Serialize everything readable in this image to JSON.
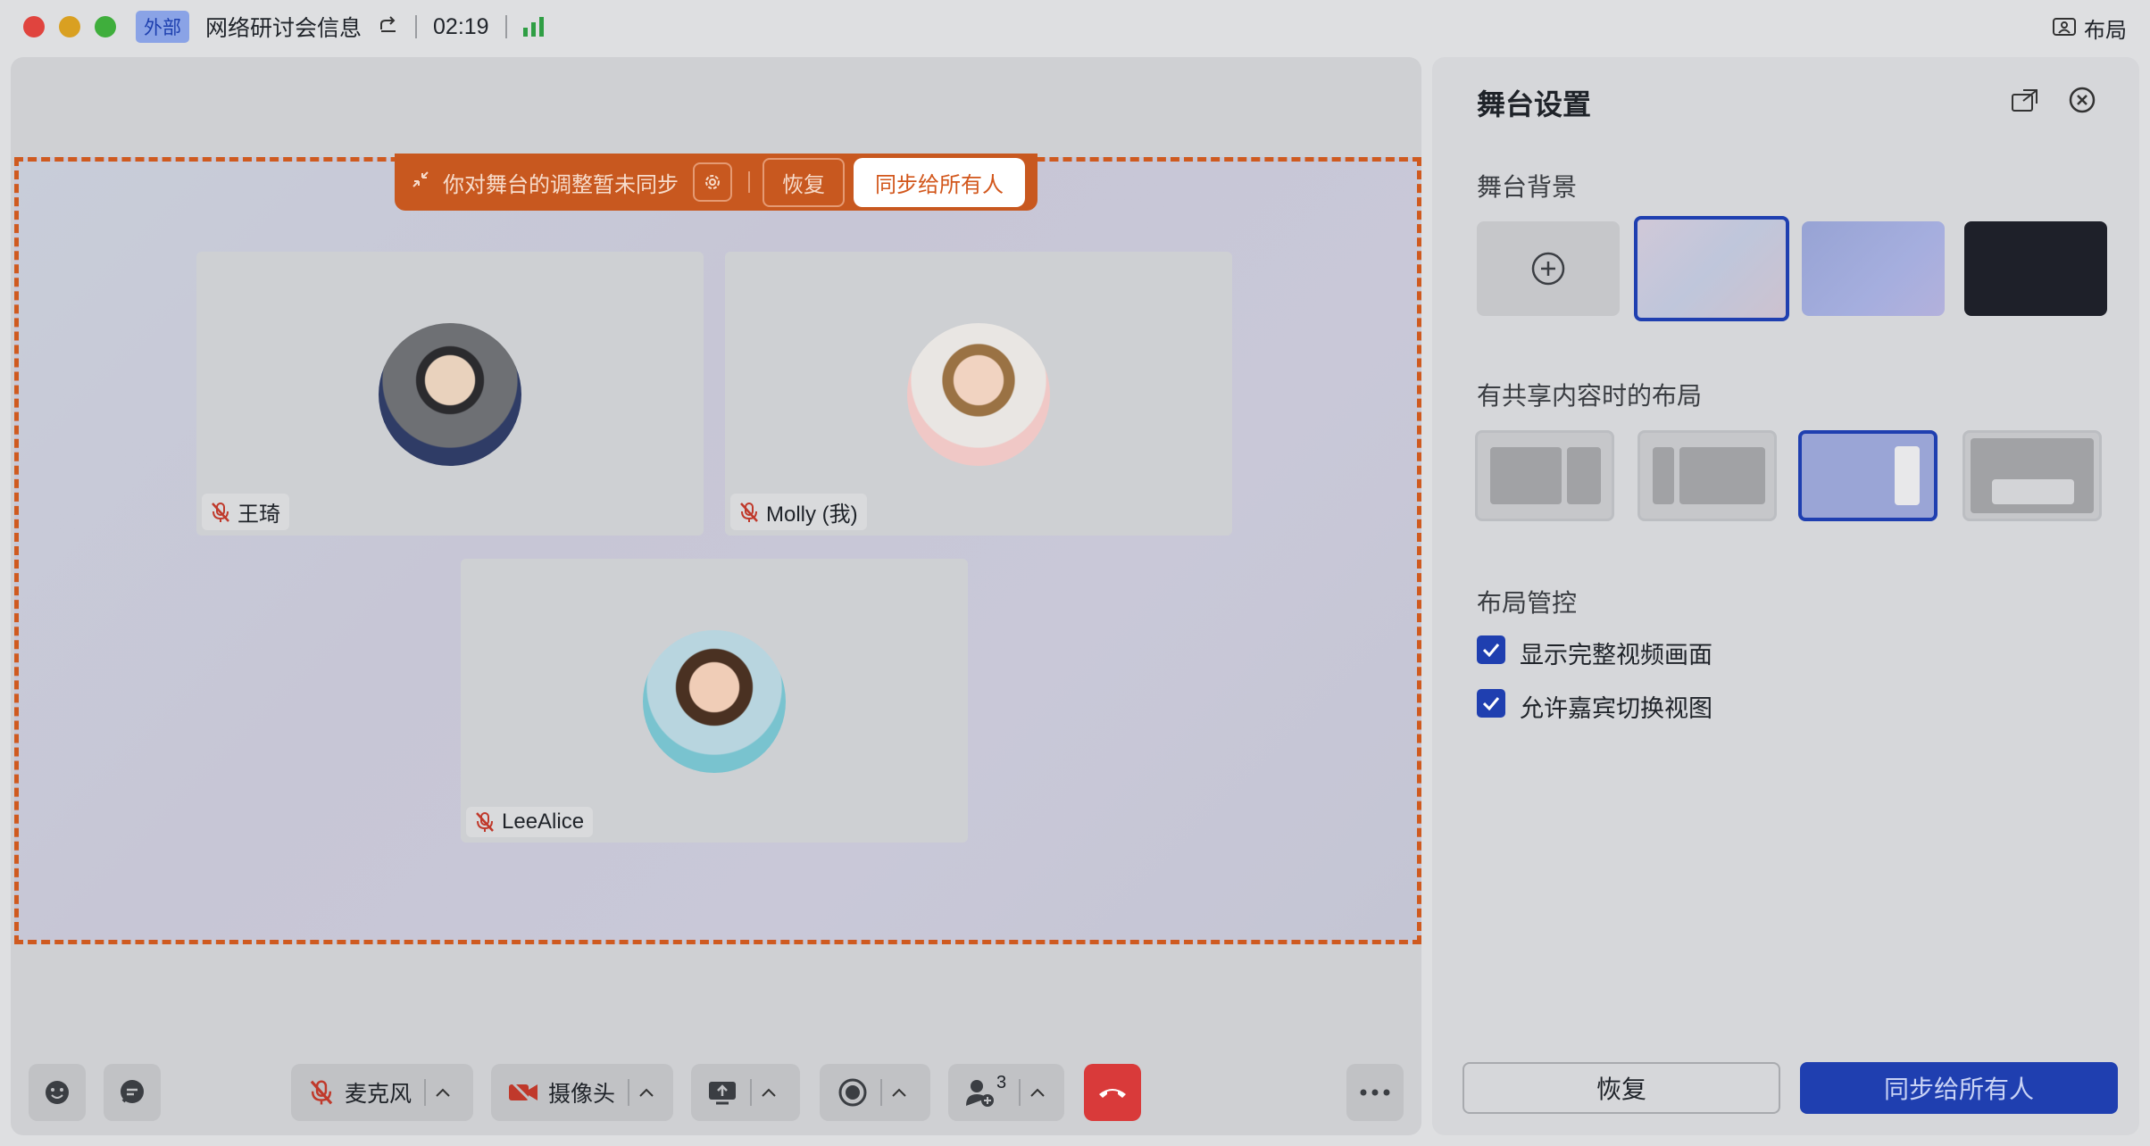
{
  "titlebar": {
    "tag": "外部",
    "title": "网络研讨会信息",
    "time": "02:19",
    "layout_label": "布局"
  },
  "stage": {
    "sync_notice": "你对舞台的调整暂未同步",
    "restore_label": "恢复",
    "sync_label": "同步给所有人",
    "participants": [
      {
        "name": "王琦"
      },
      {
        "name": "Molly (我)"
      },
      {
        "name": "LeeAlice"
      }
    ]
  },
  "toolbar": {
    "mic_label": "麦克风",
    "camera_label": "摄像头",
    "participants_count": "3"
  },
  "panel": {
    "title": "舞台设置",
    "bg_section": "舞台背景",
    "layout_section": "有共享内容时的布局",
    "control_section": "布局管控",
    "options": [
      {
        "label": "显示完整视频画面",
        "checked": true
      },
      {
        "label": "允许嘉宾切换视图",
        "checked": true
      }
    ],
    "restore_label": "恢复",
    "sync_label": "同步给所有人"
  },
  "colors": {
    "accent": "#1f3fb0",
    "warning": "#c8581f",
    "hangup": "#d93a3a"
  }
}
